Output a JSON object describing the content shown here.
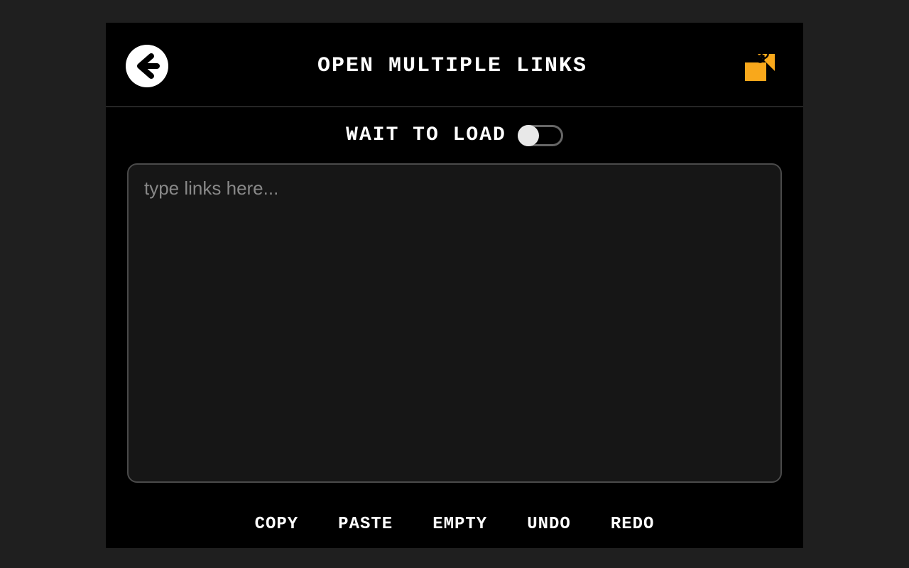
{
  "header": {
    "title": "OPEN MULTIPLE LINKS"
  },
  "toggle": {
    "label": "WAIT TO LOAD",
    "checked": false
  },
  "input": {
    "placeholder": "type links here...",
    "value": ""
  },
  "actions": {
    "copy": "COPY",
    "paste": "PASTE",
    "empty": "EMPTY",
    "undo": "UNDO",
    "redo": "REDO"
  },
  "colors": {
    "accent": "#f9a81b"
  }
}
